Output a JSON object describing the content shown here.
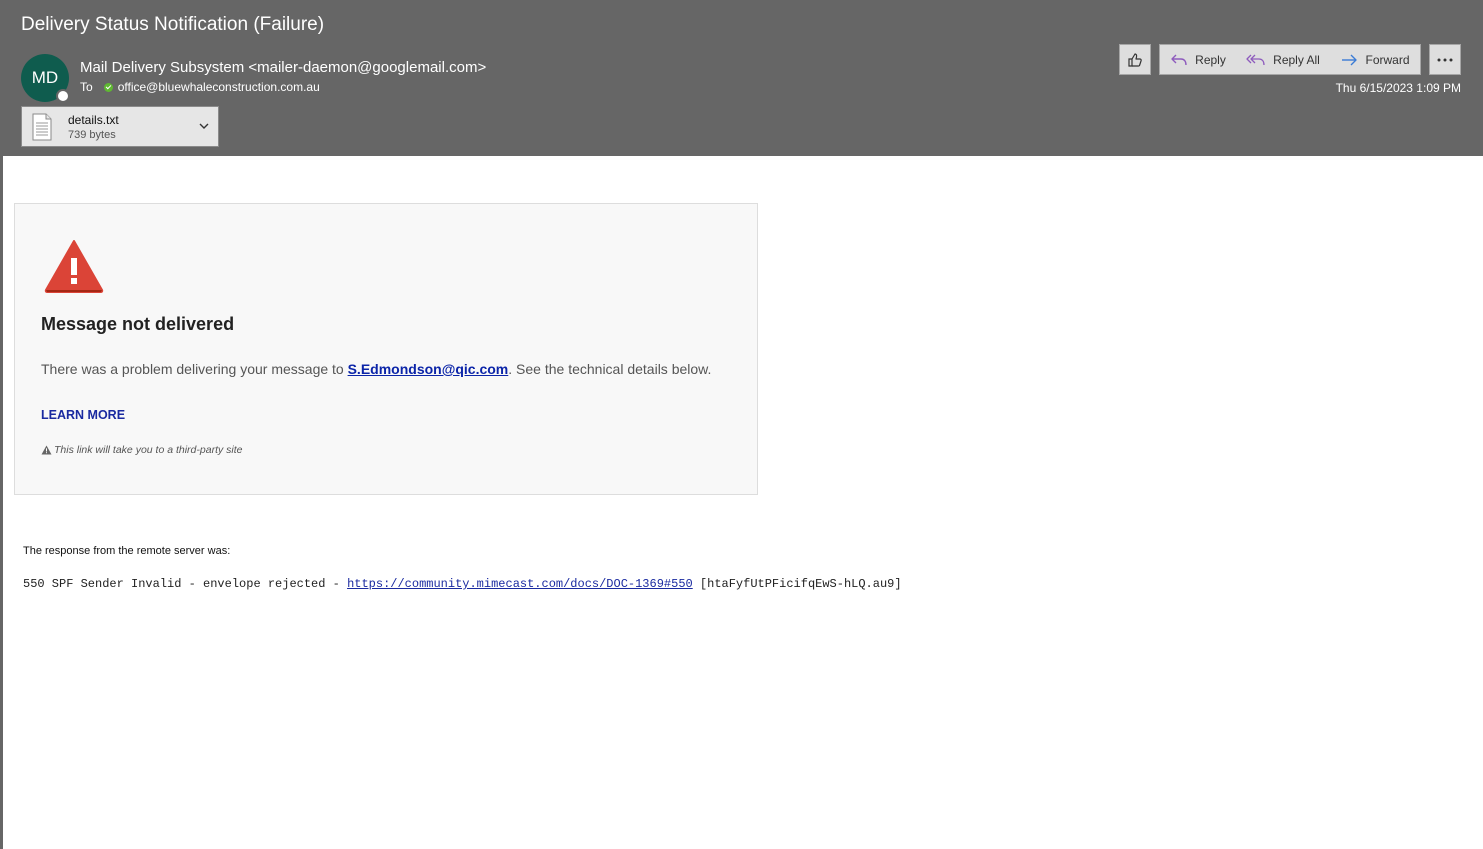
{
  "header": {
    "subject": "Delivery Status Notification (Failure)",
    "avatar_initials": "MD",
    "sender": "Mail Delivery Subsystem <mailer-daemon@googlemail.com>",
    "to_label": "To",
    "recipient": "office@bluewhaleconstruction.com.au",
    "date": "Thu 6/15/2023 1:09 PM",
    "colors": {
      "header_bg": "#666666",
      "avatar_bg": "#0f5c4e",
      "verified": "#5fb832"
    }
  },
  "attachment": {
    "name": "details.txt",
    "size": "739 bytes",
    "icon": "document-icon"
  },
  "toolbar": {
    "like_icon": "thumbs-up-icon",
    "reply_label": "Reply",
    "reply_all_label": "Reply All",
    "forward_label": "Forward",
    "more_icon": "more-options-icon"
  },
  "message": {
    "icon": "warning-triangle-icon",
    "title": "Message not delivered",
    "text_before": "There was a problem delivering your message to ",
    "address": "S.Edmondson@qic.com",
    "text_after": ". See the technical details below.",
    "learn_more": "LEARN MORE",
    "note": "This link will take you to a third-party site",
    "response_label": "The response from the remote server was:",
    "response_prefix": "550 SPF Sender Invalid - envelope rejected - ",
    "response_link": "https://community.mimecast.com/docs/DOC-1369#550",
    "response_suffix": " [htaFyfUtPFicifqEwS-hLQ.au9]",
    "colors": {
      "warning": "#db4437",
      "link": "#1a2aa0"
    }
  }
}
